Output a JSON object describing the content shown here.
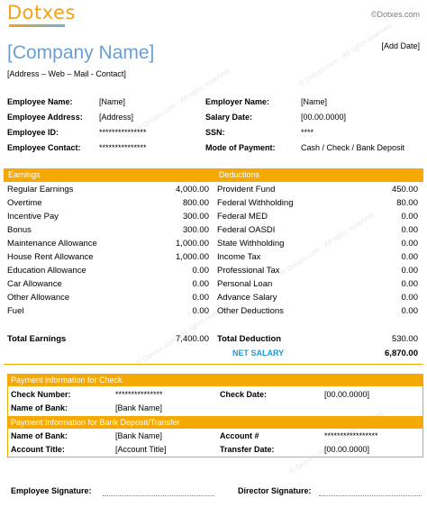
{
  "brand": {
    "logo_text": "Dotxes",
    "copyright": "©Dotxes.com",
    "add_date": "[Add Date]",
    "watermark": "© Dotxes.com - All rights reserved."
  },
  "header": {
    "company_name": "[Company Name]",
    "address_line": "[Address – Web – Mail - Contact]"
  },
  "employee_info": {
    "left": [
      {
        "label": "Employee Name:",
        "value": "[Name]"
      },
      {
        "label": "Employee Address:",
        "value": "[Address]"
      },
      {
        "label": "Employee ID:",
        "value": "***************"
      },
      {
        "label": "Employee Contact:",
        "value": "***************"
      }
    ],
    "right": [
      {
        "label": "Employer Name:",
        "value": "[Name]"
      },
      {
        "label": "Salary Date:",
        "value": "[00.00.0000]"
      },
      {
        "label": "SSN:",
        "value": "****"
      },
      {
        "label": "Mode of Payment:",
        "value": "Cash / Check / Bank Deposit"
      }
    ]
  },
  "earnings": {
    "header": "Earnings",
    "items": [
      {
        "label": "Regular Earnings",
        "amount": "4,000.00"
      },
      {
        "label": "Overtime",
        "amount": "800.00"
      },
      {
        "label": "Incentive Pay",
        "amount": "300.00"
      },
      {
        "label": "Bonus",
        "amount": "300.00"
      },
      {
        "label": "Maintenance Allowance",
        "amount": "1,000.00"
      },
      {
        "label": "House Rent Allowance",
        "amount": "1,000.00"
      },
      {
        "label": "Education Allowance",
        "amount": "0.00"
      },
      {
        "label": "Car Allowance",
        "amount": "0.00"
      },
      {
        "label": "Other Allowance",
        "amount": "0.00"
      },
      {
        "label": "Fuel",
        "amount": "0.00"
      }
    ],
    "total_label": "Total Earnings",
    "total_amount": "7,400.00"
  },
  "deductions": {
    "header": "Deductions",
    "items": [
      {
        "label": "Provident Fund",
        "amount": "450.00"
      },
      {
        "label": "Federal Withholding",
        "amount": "80.00"
      },
      {
        "label": "Federal MED",
        "amount": "0.00"
      },
      {
        "label": "Federal OASDI",
        "amount": "0.00"
      },
      {
        "label": "State Withholding",
        "amount": "0.00"
      },
      {
        "label": "Income Tax",
        "amount": "0.00"
      },
      {
        "label": "Professional Tax",
        "amount": "0.00"
      },
      {
        "label": "Personal Loan",
        "amount": "0.00"
      },
      {
        "label": "Advance Salary",
        "amount": "0.00"
      },
      {
        "label": "Other Deductions",
        "amount": "0.00"
      }
    ],
    "total_label": "Total Deduction",
    "total_amount": "530.00",
    "net_label": "NET SALARY",
    "net_amount": "6,870.00"
  },
  "check_info": {
    "header": "Payment information for Check",
    "check_number_label": "Check  Number:",
    "check_number_value": "***************",
    "check_date_label": "Check Date:",
    "check_date_value": "[00.00.0000]",
    "bank_label": "Name of Bank:",
    "bank_value": "[Bank Name]"
  },
  "bank_info": {
    "header": "Payment Information for Bank Deposit/Transfer",
    "bank_label": "Name of Bank:",
    "bank_value": "[Bank Name]",
    "account_label": "Account #",
    "account_value": "*****************",
    "account_title_label": "Account Title:",
    "account_title_value": "[Account Title]",
    "transfer_date_label": "Transfer Date:",
    "transfer_date_value": "[00.00.0000]"
  },
  "signatures": {
    "employee_label": "Employee Signature:",
    "director_label": "Director  Signature:"
  },
  "colors": {
    "accent": "#f5a905",
    "company_blue": "#6a9fd4",
    "net_blue": "#1c9ad6"
  }
}
